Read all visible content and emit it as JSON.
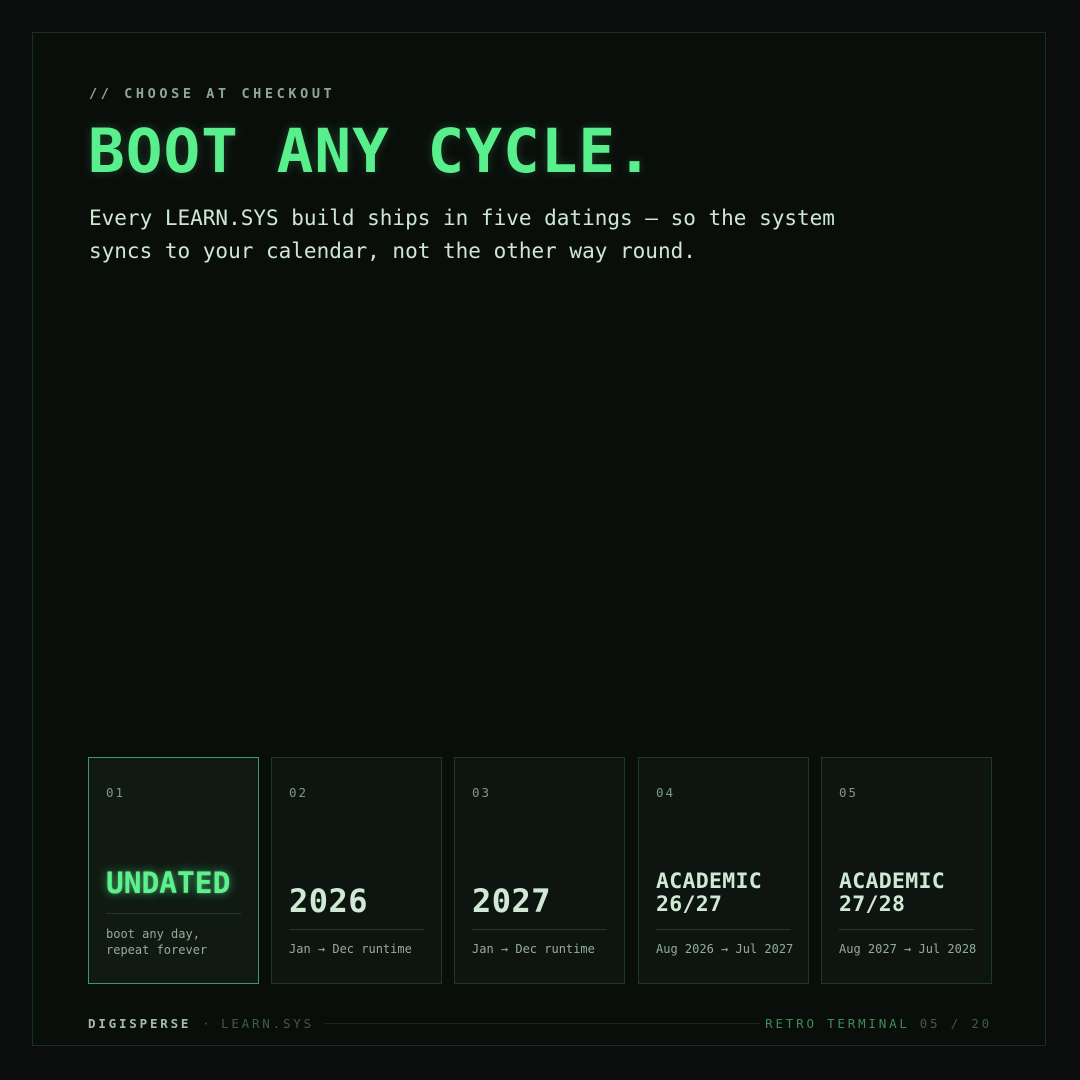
{
  "header": {
    "eyebrow": "// CHOOSE AT CHECKOUT",
    "title": "BOOT ANY CYCLE.",
    "subtitle": "Every LEARN.SYS build ships in five datings — so the system syncs to your calendar, not the other way round."
  },
  "cards": [
    {
      "num": "01",
      "label": "UNDATED",
      "desc": "boot any day,\nrepeat forever",
      "selected": true
    },
    {
      "num": "02",
      "label": "2026",
      "desc": "Jan → Dec runtime"
    },
    {
      "num": "03",
      "label": "2027",
      "desc": "Jan → Dec runtime"
    },
    {
      "num": "04",
      "label": "ACADEMIC\n26/27",
      "desc": "Aug 2026 → Jul 2027"
    },
    {
      "num": "05",
      "label": "ACADEMIC\n27/28",
      "desc": "Aug 2027 → Jul 2028"
    }
  ],
  "footer": {
    "brand": "DIGISPERSE",
    "separator": "·",
    "product": "LEARN.SYS",
    "theme": "RETRO TERMINAL",
    "page": "05 / 20"
  },
  "colors": {
    "accent": "#59ef8c",
    "background": "#0a0d0b",
    "card_border": "#1c3a26",
    "selected_border": "#3f9a5e"
  }
}
